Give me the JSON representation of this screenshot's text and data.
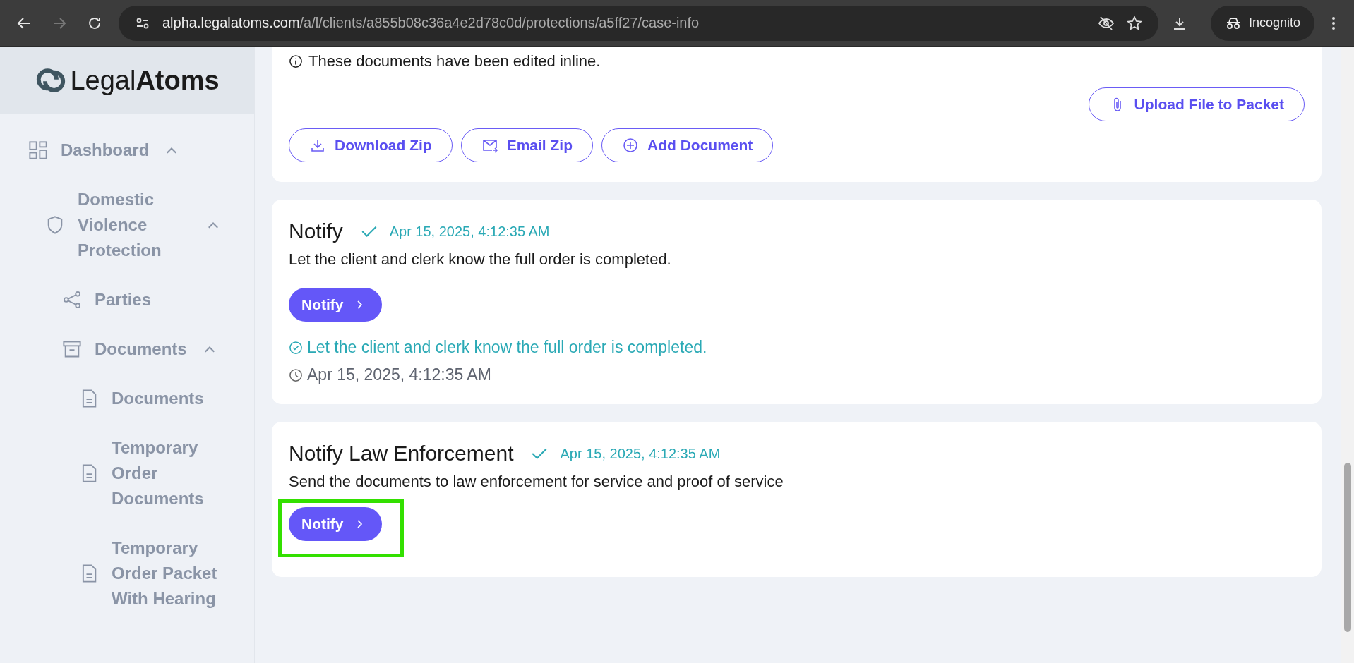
{
  "browser": {
    "url_host": "alpha.legalatoms.com",
    "url_path": "/a/l/clients/a855b08c36a4e2d78c0d/protections/a5ff27/case-info",
    "profile": "Incognito"
  },
  "sidebar": {
    "logo": {
      "light": "Legal",
      "bold": "Atoms"
    },
    "items": [
      {
        "label": "Dashboard",
        "kind": "grid",
        "expanded": true,
        "children": [
          {
            "label": "Domestic Violence Protection",
            "kind": "shield",
            "expanded": true,
            "children": [
              {
                "label": "Parties",
                "kind": "share"
              },
              {
                "label": "Documents",
                "kind": "archive",
                "expanded": true,
                "children": [
                  {
                    "label": "Documents",
                    "kind": "file"
                  },
                  {
                    "label": "Temporary Order Documents",
                    "kind": "file"
                  },
                  {
                    "label": "Temporary Order Packet With Hearing",
                    "kind": "file"
                  }
                ]
              }
            ]
          }
        ]
      }
    ]
  },
  "documents_card": {
    "note": "These documents have been edited inline.",
    "upload_button": "Upload File to Packet",
    "buttons": [
      {
        "label": "Download Zip",
        "kind": "download"
      },
      {
        "label": "Email Zip",
        "kind": "email"
      },
      {
        "label": "Add Document",
        "kind": "add"
      }
    ]
  },
  "steps": [
    {
      "title": "Notify",
      "done": true,
      "timestamp": "Apr 15, 2025, 4:12:35 AM",
      "description": "Let the client and clerk know the full order is completed.",
      "button": {
        "label": "Notify",
        "highlighted": false
      },
      "result": {
        "message": "Let the client and clerk know the full order is completed.",
        "timestamp": "Apr 15, 2025, 4:12:35 AM"
      }
    },
    {
      "title": "Notify Law Enforcement",
      "done": true,
      "timestamp": "Apr 15, 2025, 4:12:35 AM",
      "description": "Send the documents to law enforcement for service and proof of service",
      "button": {
        "label": "Notify",
        "highlighted": true
      }
    }
  ]
}
